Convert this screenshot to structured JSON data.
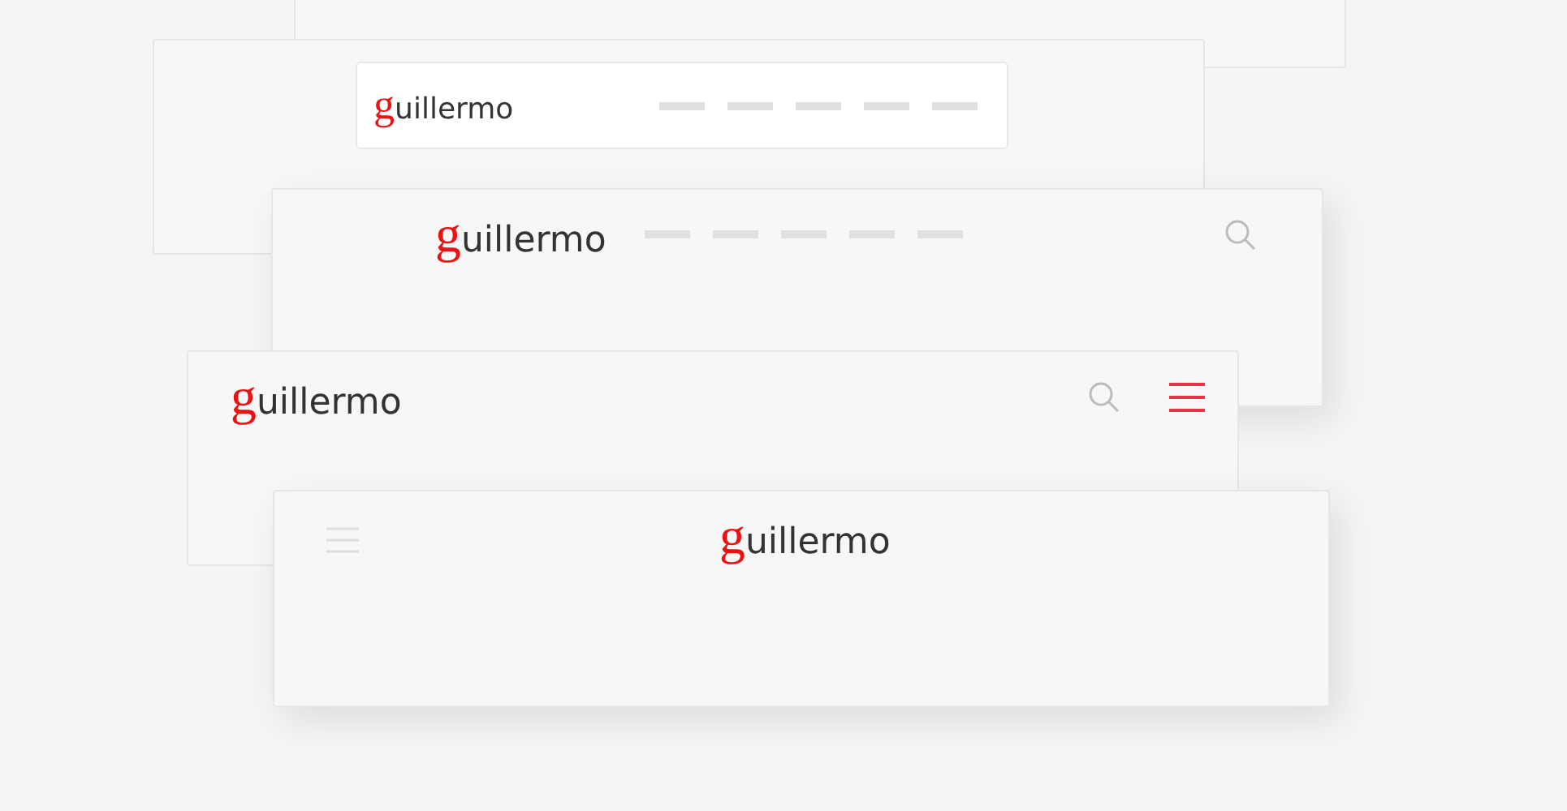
{
  "cards": [
    {
      "kind": "empty"
    },
    {
      "kind": "boxed-nav",
      "logo": {
        "initial": "g",
        "rest": "uillermo"
      }
    },
    {
      "kind": "nav-search",
      "logo": {
        "initial": "g",
        "rest": "uillermo"
      }
    },
    {
      "kind": "search-menu",
      "logo": {
        "initial": "g",
        "rest": "uillermo"
      },
      "menu_active": true
    },
    {
      "kind": "centered",
      "logo": {
        "initial": "g",
        "rest": "uillermo"
      },
      "menu_active": false
    }
  ]
}
